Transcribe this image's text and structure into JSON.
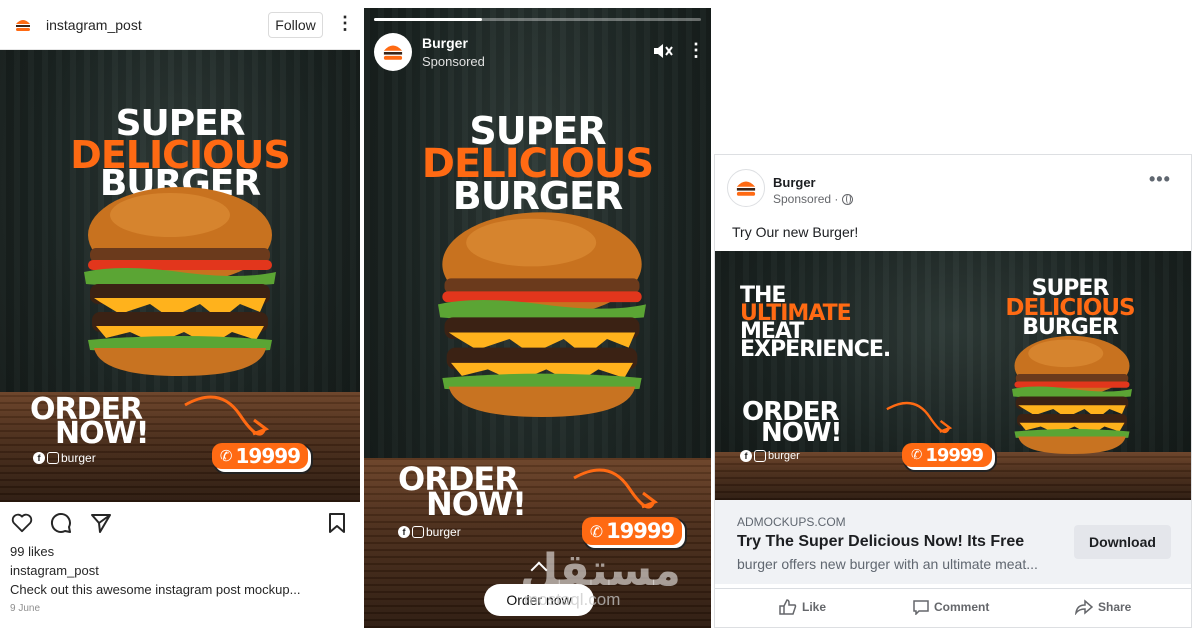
{
  "instagram": {
    "username": "instagram_post",
    "follow_label": "Follow",
    "likes": "99 likes",
    "caption_user": "instagram_post",
    "caption": "Check out this awesome instagram post mockup...",
    "date": "9 June"
  },
  "creative": {
    "super": "SUPER",
    "delicious": "DELICIOUS",
    "burger": "BURGER",
    "order_line1": "ORDER",
    "order_line2": "NOW!",
    "price": "19999",
    "social_handle": "burger",
    "meat_line1": "THE",
    "meat_line2": "ULTIMATE",
    "meat_line3": "MEAT",
    "meat_line4": "EXPERIENCE.",
    "brand_color": "#ff6a13"
  },
  "story": {
    "brand": "Burger",
    "sponsored": "Sponsored",
    "cta": "Order now",
    "progress": 0.33
  },
  "facebook": {
    "brand": "Burger",
    "sponsored": "Sponsored ·",
    "post_text": "Try Our new Burger!",
    "domain": "ADMOCKUPS.COM",
    "headline": "Try The Super Delicious Now! Its Free",
    "description": "burger offers new burger with an ultimate meat...",
    "download_label": "Download",
    "like_label": "Like",
    "comment_label": "Comment",
    "share_label": "Share"
  },
  "watermark": {
    "arabic": "مستقل",
    "latin": "mostaql.com"
  },
  "icons": [
    "heart-icon",
    "comment-icon",
    "send-icon",
    "bookmark-icon",
    "kebab-icon",
    "mute-icon",
    "globe-icon",
    "like-icon",
    "share-icon",
    "phone-icon",
    "facebook-icon",
    "instagram-icon",
    "arrow-icon"
  ]
}
